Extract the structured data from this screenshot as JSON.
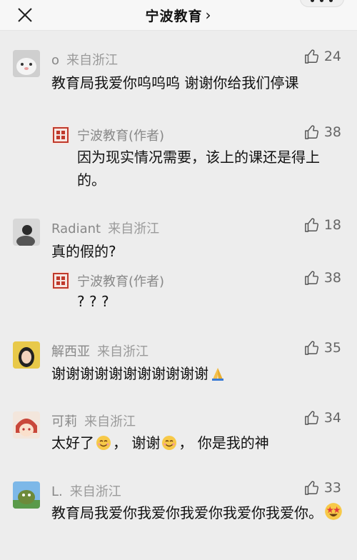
{
  "header": {
    "title": "宁波教育",
    "chevron": "›"
  },
  "comments": [
    {
      "user": "o",
      "location": "来自浙江",
      "likes": "24",
      "text": "教育局我爱你呜呜呜 谢谢你给我们停课",
      "reply": {
        "user": "宁波教育(作者)",
        "likes": "38",
        "text": "因为现实情况需要，该上的课还是得上的。"
      }
    },
    {
      "user": "Radiant",
      "location": "来自浙江",
      "likes": "18",
      "text": "真的假的?",
      "reply": {
        "user": "宁波教育(作者)",
        "likes": "38",
        "text": "? ? ?"
      }
    },
    {
      "user": "解西亚",
      "location": "来自浙江",
      "likes": "35",
      "text": "谢谢谢谢谢谢谢谢谢谢谢"
    },
    {
      "user": "可莉",
      "location": "来自浙江",
      "likes": "34",
      "text_parts": [
        "太好了",
        "，  谢谢",
        "，  你是我的神"
      ]
    },
    {
      "user": "L.",
      "location": "来自浙江",
      "likes": "33",
      "text": "教育局我爱你我爱你我爱你我爱你我爱你。"
    }
  ],
  "icons": {
    "close": "close-icon",
    "like": "thumbs-up-icon",
    "pray": "praying-hands-emoji",
    "smile": "smiling-face-emoji",
    "starstruck": "star-struck-emoji"
  }
}
